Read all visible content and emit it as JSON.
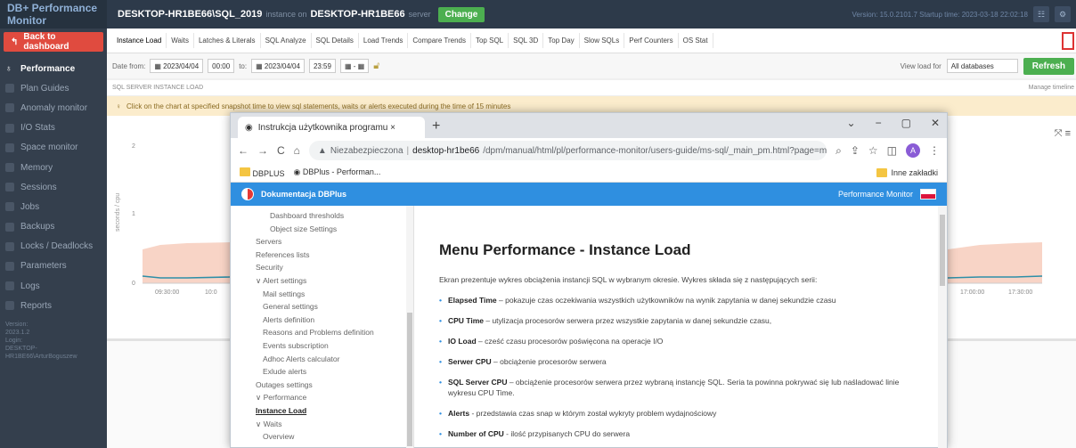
{
  "app": {
    "brand": "DB+ Performance Monitor",
    "instance_name": "DESKTOP-HR1BE66\\SQL_2019",
    "instance_on": "instance on",
    "host": "DESKTOP-HR1BE66",
    "server_suffix": "server",
    "change_label": "Change",
    "version_info": "Version: 15.0.2101.7  Startup time: 2023-03-18 22:02:18"
  },
  "sidebar": {
    "back_label": "Back to dashboard",
    "items": [
      {
        "label": "Performance",
        "active": true
      },
      {
        "label": "Plan Guides"
      },
      {
        "label": "Anomaly monitor"
      },
      {
        "label": "I/O Stats"
      },
      {
        "label": "Space monitor"
      },
      {
        "label": "Memory"
      },
      {
        "label": "Sessions"
      },
      {
        "label": "Jobs"
      },
      {
        "label": "Backups"
      },
      {
        "label": "Locks / Deadlocks"
      },
      {
        "label": "Parameters"
      },
      {
        "label": "Logs"
      },
      {
        "label": "Reports"
      }
    ],
    "version_label": "Version:",
    "version": "2023.1.2",
    "login_label": "Login:",
    "login": "DESKTOP-HR1BE66\\ArturBoguszew"
  },
  "tabs": [
    "Instance Load",
    "Waits",
    "Latches & Literals",
    "SQL Analyze",
    "SQL Details",
    "Load Trends",
    "Compare Trends",
    "Top SQL",
    "SQL 3D",
    "Top Day",
    "Slow SQLs",
    "Perf Counters",
    "OS Stat"
  ],
  "filters": {
    "date_from_label": "Date from:",
    "date_from": "2023/04/04",
    "time_from": "00:00",
    "to_label": "to:",
    "date_to": "2023/04/04",
    "time_to": "23:59",
    "view_load_label": "View load for",
    "db_select": "All databases",
    "refresh_label": "Refresh"
  },
  "section": {
    "title": "SQL SERVER INSTANCE LOAD",
    "manage": "Manage timeline"
  },
  "notice": "Click on the chart at specified snapshot time to view sql statements, waits or alerts executed during the time of 15 minutes",
  "chart": {
    "ylabel": "seconds / cpu",
    "yticks": [
      "2",
      "1",
      "0"
    ],
    "xticks": [
      "09:30:00",
      "10:0",
      "17:00:00",
      "17:30:00"
    ]
  },
  "browser": {
    "tab_title": "Instrukcja użytkownika programu ×",
    "insecure": "Niezabezpieczona",
    "url_host": "desktop-hr1be66",
    "url_path": "/dpm/manual/html/pl/performance-monitor/users-guide/ms-sql/_main_pm.html?page=m-performanc...",
    "avatar": "A",
    "bookmark1": "DBPLUS",
    "bookmark2": "DBPlus - Performan...",
    "other_bookmarks": "Inne zakładki"
  },
  "doc": {
    "header_title": "Dokumentacja DBPlus",
    "header_right": "Performance Monitor",
    "toc": [
      {
        "label": "Dashboard thresholds",
        "level": 3
      },
      {
        "label": "Object size Settings",
        "level": 3
      },
      {
        "label": "Servers",
        "level": 1
      },
      {
        "label": "References lists",
        "level": 1
      },
      {
        "label": "Security",
        "level": 1
      },
      {
        "label": "∨ Alert settings",
        "level": 1
      },
      {
        "label": "Mail settings",
        "level": 2
      },
      {
        "label": "General settings",
        "level": 2
      },
      {
        "label": "Alerts definition",
        "level": 2
      },
      {
        "label": "Reasons and Problems definition",
        "level": 2
      },
      {
        "label": "Events subscription",
        "level": 2
      },
      {
        "label": "Adhoc Alerts calculator",
        "level": 2
      },
      {
        "label": "Exlude alerts",
        "level": 2
      },
      {
        "label": "Outages settings",
        "level": 1
      },
      {
        "label": "∨ Performance",
        "level": 0
      },
      {
        "label": "Instance Load",
        "level": 1,
        "bold": true
      },
      {
        "label": "∨ Waits",
        "level": 1
      },
      {
        "label": "Overview",
        "level": 2
      }
    ],
    "heading": "Menu Performance - Instance Load",
    "lead": "Ekran prezentuje wykres obciążenia instancji SQL w wybranym okresie. Wykres składa się z następujących serii:",
    "bullets": [
      {
        "term": "Elapsed Time",
        "text": " – pokazuje czas oczekiwania wszystkich użytkowników na wynik zapytania w danej sekundzie czasu"
      },
      {
        "term": "CPU Time",
        "text": " – utylizacja procesorów serwera przez wszystkie zapytania w danej sekundzie czasu,"
      },
      {
        "term": "IO Load",
        "text": " – cześć czasu procesorów poświęcona na operacje I/O"
      },
      {
        "term": "Serwer CPU",
        "text": " – obciążenie procesorów serwera"
      },
      {
        "term": "SQL Server CPU",
        "text": " – obciążenie procesorów serwera przez wybraną instancję SQL. Seria ta powinna pokrywać się lub naśladować linie wykresu CPU Time."
      },
      {
        "term": "Alerts",
        "text": " - przedstawia czas snap w którym został wykryty problem wydajnościowy"
      },
      {
        "term": "Number of CPU",
        "text": " - ilość przypisanych CPU do serwera"
      }
    ]
  }
}
